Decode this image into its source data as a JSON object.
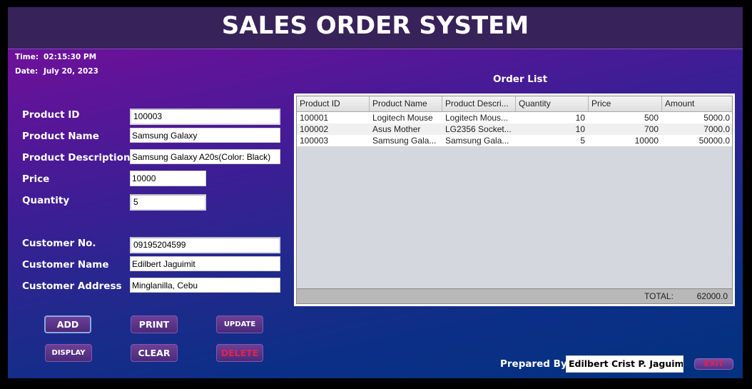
{
  "header": {
    "title": "SALES ORDER SYSTEM"
  },
  "clock": {
    "time_label": "Time:",
    "time_value": "02:15:30 PM",
    "date_label": "Date:",
    "date_value": "July 20, 2023"
  },
  "product_form": {
    "product_id": {
      "label": "Product ID",
      "value": "100003"
    },
    "product_name": {
      "label": "Product Name",
      "value": "Samsung Galaxy"
    },
    "product_description": {
      "label": "Product Description",
      "value": "Samsung Galaxy A20s(Color: Black)"
    },
    "price": {
      "label": "Price",
      "value": "10000"
    },
    "quantity": {
      "label": "Quantity",
      "value": "5"
    }
  },
  "customer_form": {
    "customer_no": {
      "label": "Customer No.",
      "value": "09195204599"
    },
    "customer_name": {
      "label": "Customer Name",
      "value": "Edilbert Jaguimit"
    },
    "customer_address": {
      "label": "Customer Address",
      "value": "Minglanilla, Cebu"
    }
  },
  "buttons": {
    "add": "ADD",
    "print": "PRINT",
    "update": "UPDATE",
    "display": "DISPLAY",
    "clear": "CLEAR",
    "delete": "DELETE",
    "exit": "EXIT"
  },
  "order_list": {
    "title": "Order List",
    "columns": [
      "Product ID",
      "Product Name",
      "Product Descri...",
      "Quantity",
      "Price",
      "Amount"
    ],
    "rows": [
      [
        "100001",
        "Logitech Mouse",
        "Logitech Mous...",
        "10",
        "500",
        "5000.0"
      ],
      [
        "100002",
        "Asus Mother",
        "LG2356 Socket...",
        "10",
        "700",
        "7000.0"
      ],
      [
        "100003",
        "Samsung Gala...",
        "Samsung Gala...",
        "5",
        "10000",
        "50000.0"
      ]
    ],
    "total_label": "TOTAL:",
    "total_value": "62000.0"
  },
  "footer": {
    "prepared_by_label": "Prepared By:",
    "prepared_by_value": "Edilbert Crist P. Jaguimit"
  },
  "colors": {
    "header_bg": "#372259",
    "delete_text": "#e0244a",
    "bg_top": "#7a0f9c",
    "bg_bottom": "#03327f"
  }
}
